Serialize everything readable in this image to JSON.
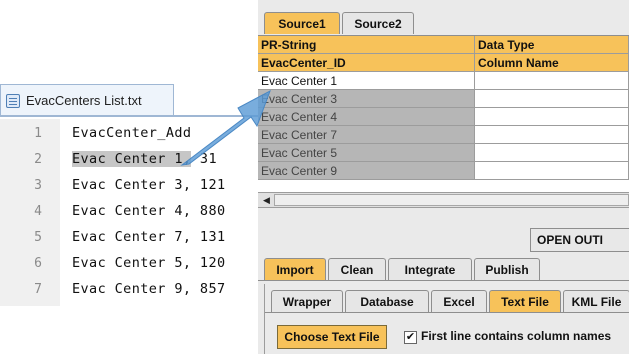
{
  "editor": {
    "tab_title": "EvacCenters List.txt",
    "lines": [
      {
        "num": "1",
        "text": "EvacCenter_",
        "tail": "Add"
      },
      {
        "num": "2",
        "text": "Evac Center 1,",
        "tail": " 31"
      },
      {
        "num": "3",
        "text": "Evac Center 3,",
        "tail": " 121"
      },
      {
        "num": "4",
        "text": "Evac Center 4,",
        "tail": " 880"
      },
      {
        "num": "5",
        "text": "Evac Center 7,",
        "tail": " 131"
      },
      {
        "num": "6",
        "text": "Evac Center 5,",
        "tail": " 120"
      },
      {
        "num": "7",
        "text": "Evac Center 9,",
        "tail": " 857"
      }
    ]
  },
  "source_tabs": [
    "Source1",
    "Source2"
  ],
  "grid": {
    "header_rows": [
      [
        "PR-String",
        "Data Type"
      ],
      [
        "EvacCenter_ID",
        "Column Name"
      ]
    ],
    "rows": [
      "Evac Center 1",
      "Evac Center 3",
      "Evac Center 4",
      "Evac Center 7",
      "Evac Center 5",
      "Evac Center 9"
    ]
  },
  "open_button_label": "OPEN OUTI",
  "main_tabs": [
    "Import",
    "Clean",
    "Integrate",
    "Publish"
  ],
  "sub_tabs": [
    "Wrapper",
    "Database",
    "Excel",
    "Text File",
    "KML File"
  ],
  "choose_button_label": "Choose Text File",
  "checkbox": {
    "checked": true,
    "mark": "✔",
    "label": "First line contains column names"
  },
  "colors": {
    "accent": "#f7c25a",
    "arrow": "#5b9bd5"
  }
}
